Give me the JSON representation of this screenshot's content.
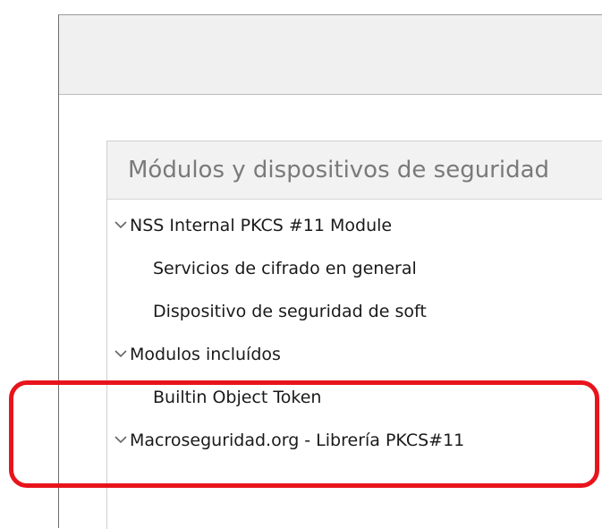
{
  "panel": {
    "header": "Módulos y dispositivos de seguridad"
  },
  "tree": {
    "items": [
      {
        "label": "NSS Internal PKCS #11 Module",
        "icon": "chevron-down-icon"
      },
      {
        "label": "Servicios de cifrado en general"
      },
      {
        "label": "Dispositivo de seguridad de soft"
      },
      {
        "label": "Modulos incluídos",
        "icon": "chevron-down-icon"
      },
      {
        "label": "Builtin Object Token"
      },
      {
        "label": "Macroseguridad.org - Librería PKCS#11",
        "icon": "chevron-down-icon"
      }
    ]
  },
  "annotation": {
    "color": "#e8141c"
  }
}
